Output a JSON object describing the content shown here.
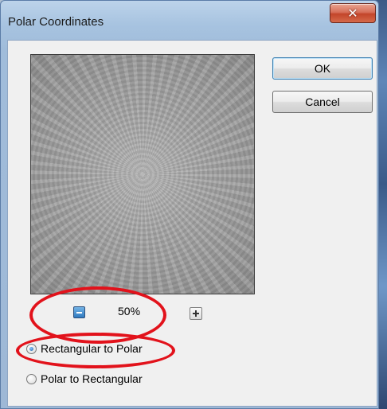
{
  "window": {
    "title": "Polar Coordinates",
    "close_glyph": "✕"
  },
  "buttons": {
    "ok": "OK",
    "cancel": "Cancel"
  },
  "zoom": {
    "value": "50%",
    "out_icon": "zoom-out-icon",
    "in_icon": "zoom-in-icon"
  },
  "options": [
    {
      "label": "Rectangular to Polar",
      "checked": true
    },
    {
      "label": "Polar to Rectangular",
      "checked": false
    }
  ],
  "colors": {
    "annotation_red": "#e2121b",
    "close_button": "#c3452a"
  }
}
